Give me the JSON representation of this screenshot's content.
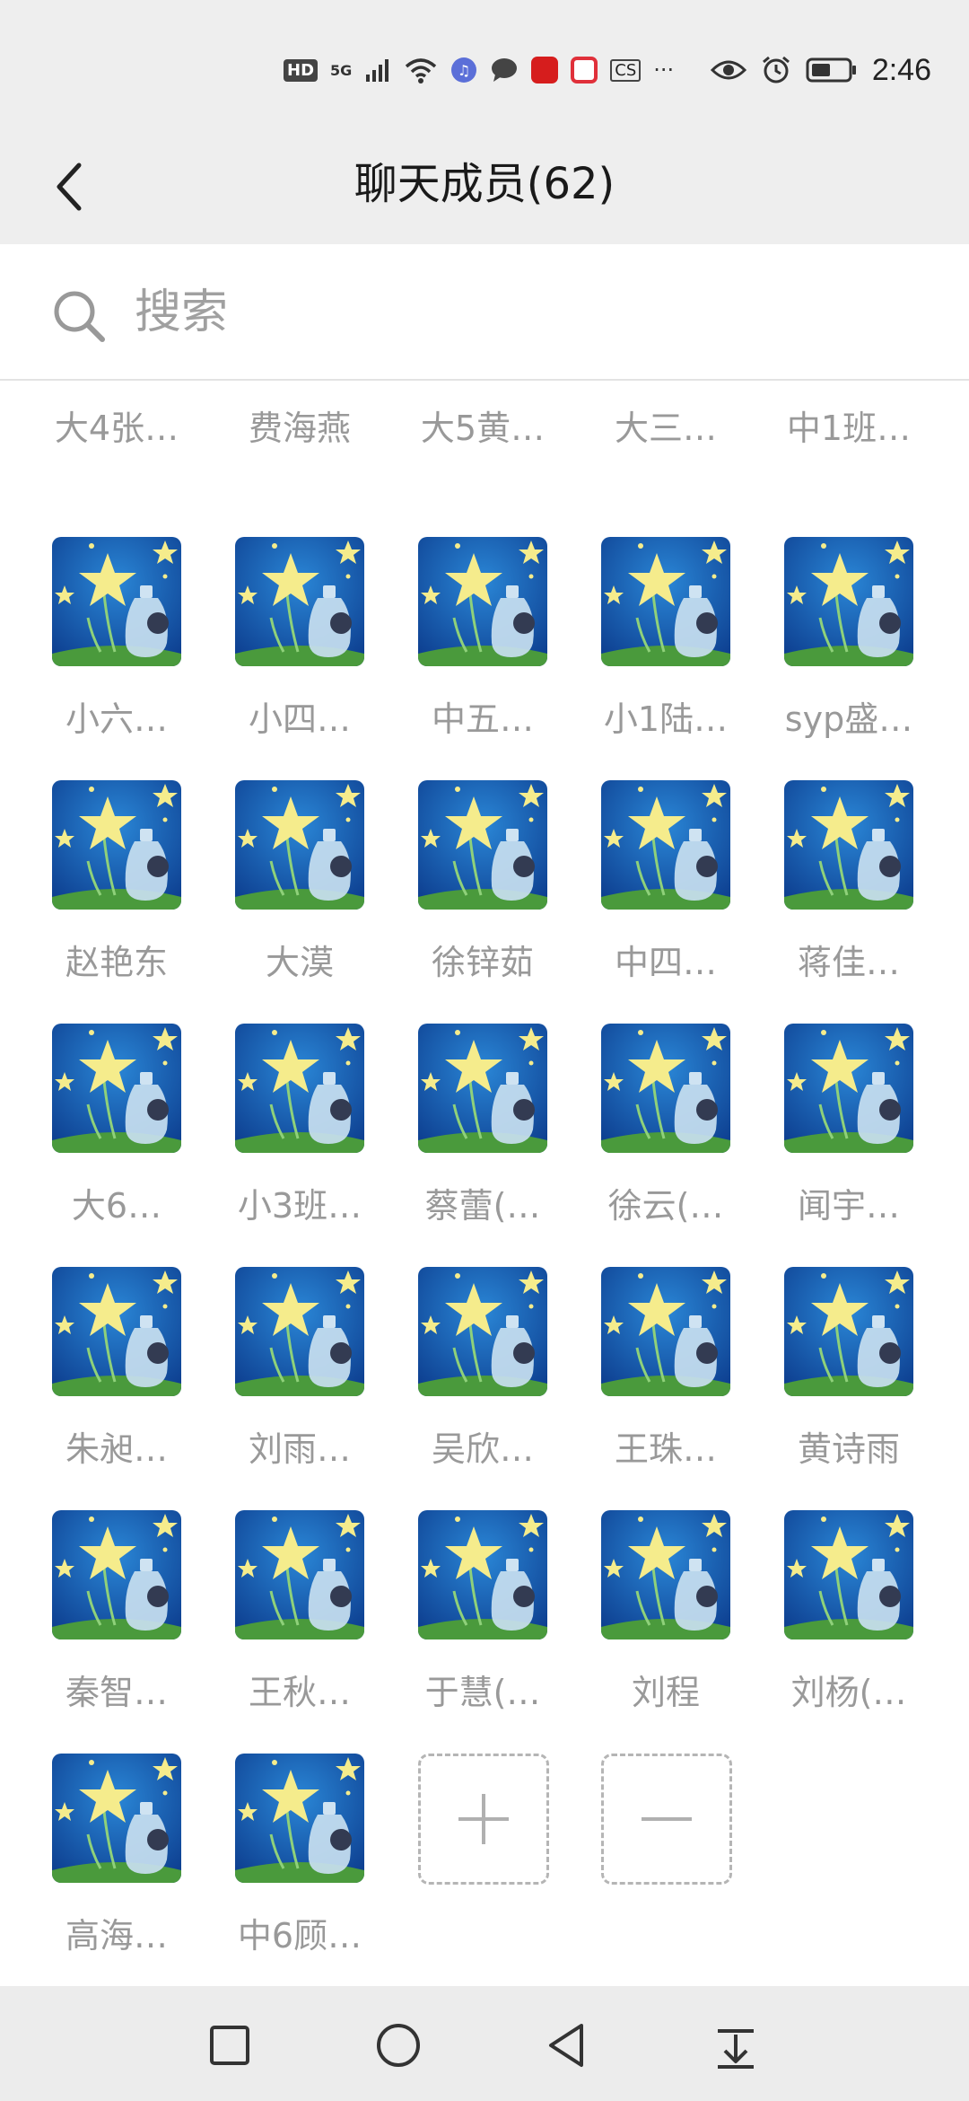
{
  "status_bar": {
    "hd": "HD",
    "network": "5G",
    "cs": "CS",
    "more": "···",
    "time": "2:46",
    "icons": [
      "hd-icon",
      "signal-icon",
      "wifi-icon",
      "music-icon",
      "chat-icon",
      "app-icon",
      "book-icon",
      "cs-icon",
      "more-icon",
      "eye-icon",
      "alarm-icon",
      "battery-icon"
    ]
  },
  "header": {
    "title": "聊天成员(62)",
    "back_icon": "chevron-left-icon"
  },
  "search": {
    "placeholder": "搜索",
    "value": ""
  },
  "members": {
    "partial_row": [
      "大4张…",
      "费海燕",
      "大5黄…",
      "大三…",
      "中1班…"
    ],
    "rows": [
      [
        "小六…",
        "小四…",
        "中五…",
        "小1陆…",
        "syp盛…"
      ],
      [
        "赵艳东",
        "大漠",
        "徐锌茹",
        "中四…",
        "蒋佳…"
      ],
      [
        "大6…",
        "小3班…",
        "蔡蕾(…",
        "徐云(…",
        "闻宇…"
      ],
      [
        "朱昶…",
        "刘雨…",
        "吴欣…",
        "王珠…",
        "黄诗雨"
      ],
      [
        "秦智…",
        "王秋…",
        "于慧(…",
        "刘程",
        "刘杨(…"
      ],
      [
        "高海…",
        "中6顾…"
      ]
    ],
    "add_icon": "plus-icon",
    "remove_icon": "minus-icon"
  },
  "system_nav": [
    "recent-apps-icon",
    "home-icon",
    "back-icon",
    "notification-pull-icon"
  ]
}
